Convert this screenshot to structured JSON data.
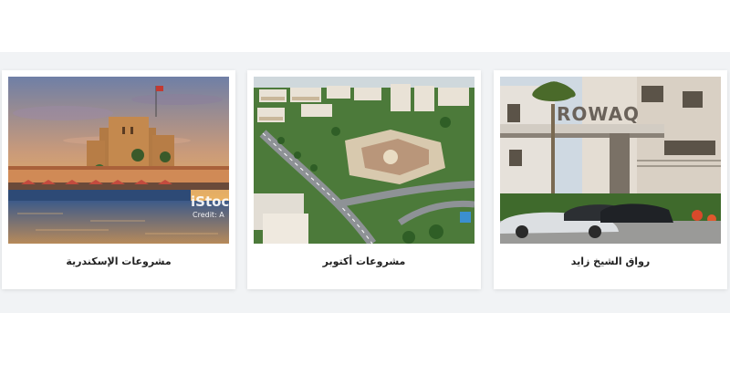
{
  "projects": [
    {
      "title": "مشروعات الإسكندرية",
      "watermark": {
        "brand": "iStoc",
        "credit": "Credit: A"
      }
    },
    {
      "title": "مشروعات أكتوبر"
    },
    {
      "title": "رواق الشيخ زايد",
      "sign_text": "ROWAQ"
    }
  ],
  "colors": {
    "band_background": "#f1f3f5",
    "card_background": "#ffffff",
    "caption_text": "#222222"
  }
}
